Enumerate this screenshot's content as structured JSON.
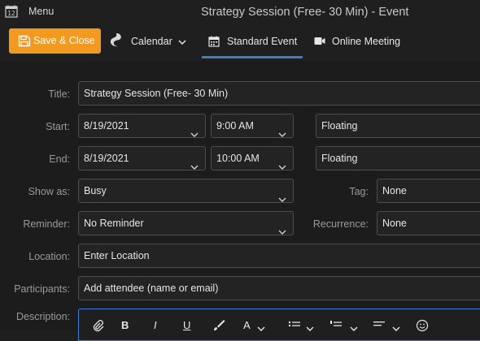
{
  "app": {
    "menu_label": "Menu",
    "window_title": "Strategy Session (Free- 30 Min) - Event",
    "calendar_icon_text": "12"
  },
  "toolbar": {
    "save_close_label": "Save & Close",
    "calendar_label": "Calendar",
    "tabs": [
      {
        "label": "Standard Event",
        "active": true
      },
      {
        "label": "Online Meeting",
        "active": false
      }
    ],
    "accent_color": "#f29a1f",
    "active_tab_color": "#3b7fc4"
  },
  "form": {
    "title": {
      "label": "Title:",
      "value": "Strategy Session (Free- 30 Min)"
    },
    "start": {
      "label": "Start:",
      "date": "8/19/2021",
      "time": "9:00 AM",
      "timezone": "Floating"
    },
    "end": {
      "label": "End:",
      "date": "8/19/2021",
      "time": "10:00 AM",
      "timezone": "Floating"
    },
    "show_as": {
      "label": "Show as:",
      "value": "Busy"
    },
    "tag": {
      "label": "Tag:",
      "value": "None"
    },
    "reminder": {
      "label": "Reminder:",
      "value": "No Reminder"
    },
    "recurrence": {
      "label": "Recurrence:",
      "value": "None"
    },
    "location": {
      "label": "Location:",
      "placeholder": "Enter Location"
    },
    "participants": {
      "label": "Participants:",
      "placeholder": "Add attendee (name or email)"
    },
    "description": {
      "label": "Description:"
    }
  },
  "formatting_toolbar": {
    "icons": [
      "attachment-icon",
      "bold-icon",
      "italic-icon",
      "underline-icon",
      "brush-icon",
      "font-color-icon",
      "bullet-list-icon",
      "numbered-list-icon",
      "align-icon",
      "emoji-icon"
    ],
    "bold_glyph": "B",
    "italic_glyph": "I",
    "underline_glyph": "U",
    "font_color_glyph": "A"
  }
}
